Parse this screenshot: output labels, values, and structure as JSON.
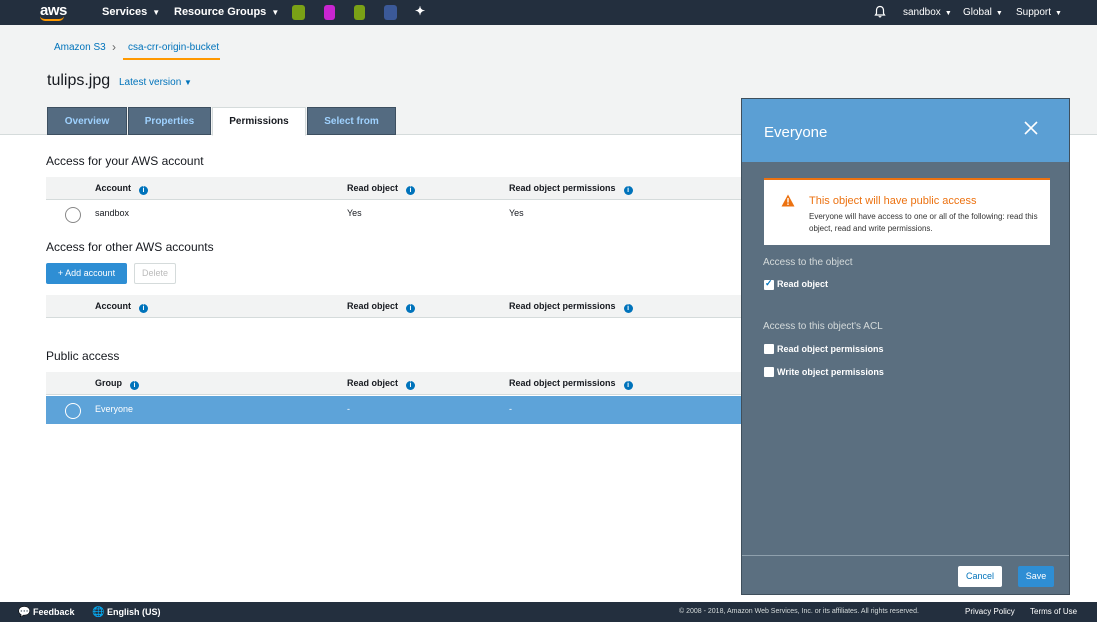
{
  "nav": {
    "logo": "aws",
    "services": "Services",
    "resource_groups": "Resource Groups",
    "account": "sandbox",
    "region": "Global",
    "support": "Support",
    "service_icons": [
      "cloud9-icon",
      "codepipeline-icon",
      "codecommit-icon",
      "ec2-icon",
      "pin-icon"
    ]
  },
  "breadcrumb": {
    "root": "Amazon S3",
    "bucket": "csa-crr-origin-bucket"
  },
  "object": {
    "title": "tulips.jpg",
    "version": "Latest version"
  },
  "tabs": [
    {
      "label": "Overview"
    },
    {
      "label": "Properties"
    },
    {
      "label": "Permissions"
    },
    {
      "label": "Select from"
    }
  ],
  "own_account": {
    "heading": "Access for your AWS account",
    "columns": [
      "Account",
      "Read object",
      "Read object permissions"
    ],
    "rows": [
      {
        "account": "sandbox",
        "read_object": "Yes",
        "read_permissions": "Yes"
      }
    ]
  },
  "other_accounts": {
    "heading": "Access for other AWS accounts",
    "add_label": "+ Add account",
    "delete_label": "Delete",
    "columns": [
      "Account",
      "Read object",
      "Read object permissions"
    ]
  },
  "public_access": {
    "heading": "Public access",
    "columns": [
      "Group",
      "Read object",
      "Read object permissions"
    ],
    "rows": [
      {
        "group": "Everyone",
        "read_object": "-",
        "read_permissions": "-"
      }
    ]
  },
  "panel": {
    "title": "Everyone",
    "alert_title": "This object will have public access",
    "alert_body": "Everyone will have access to one or all of the following: read this object, read and write permissions.",
    "object_access_label": "Access to the object",
    "read_object": {
      "label": "Read object",
      "checked": true
    },
    "acl_label": "Access to this object's ACL",
    "read_permissions": {
      "label": "Read object permissions",
      "checked": false
    },
    "write_permissions": {
      "label": "Write object permissions",
      "checked": false
    },
    "cancel_label": "Cancel",
    "save_label": "Save"
  },
  "footer": {
    "feedback": "Feedback",
    "language": "English (US)",
    "copyright": "© 2008 - 2018, Amazon Web Services, Inc. or its affiliates. All rights reserved.",
    "privacy": "Privacy Policy",
    "terms": "Terms of Use"
  },
  "colors": {
    "nav_bg": "#232f3e",
    "accent": "#ff9900",
    "link": "#0073bb",
    "selected_row": "#5da3d9",
    "panel_bg": "#5b6f80",
    "panel_header": "#5b9fd4",
    "warning": "#ec7211"
  }
}
